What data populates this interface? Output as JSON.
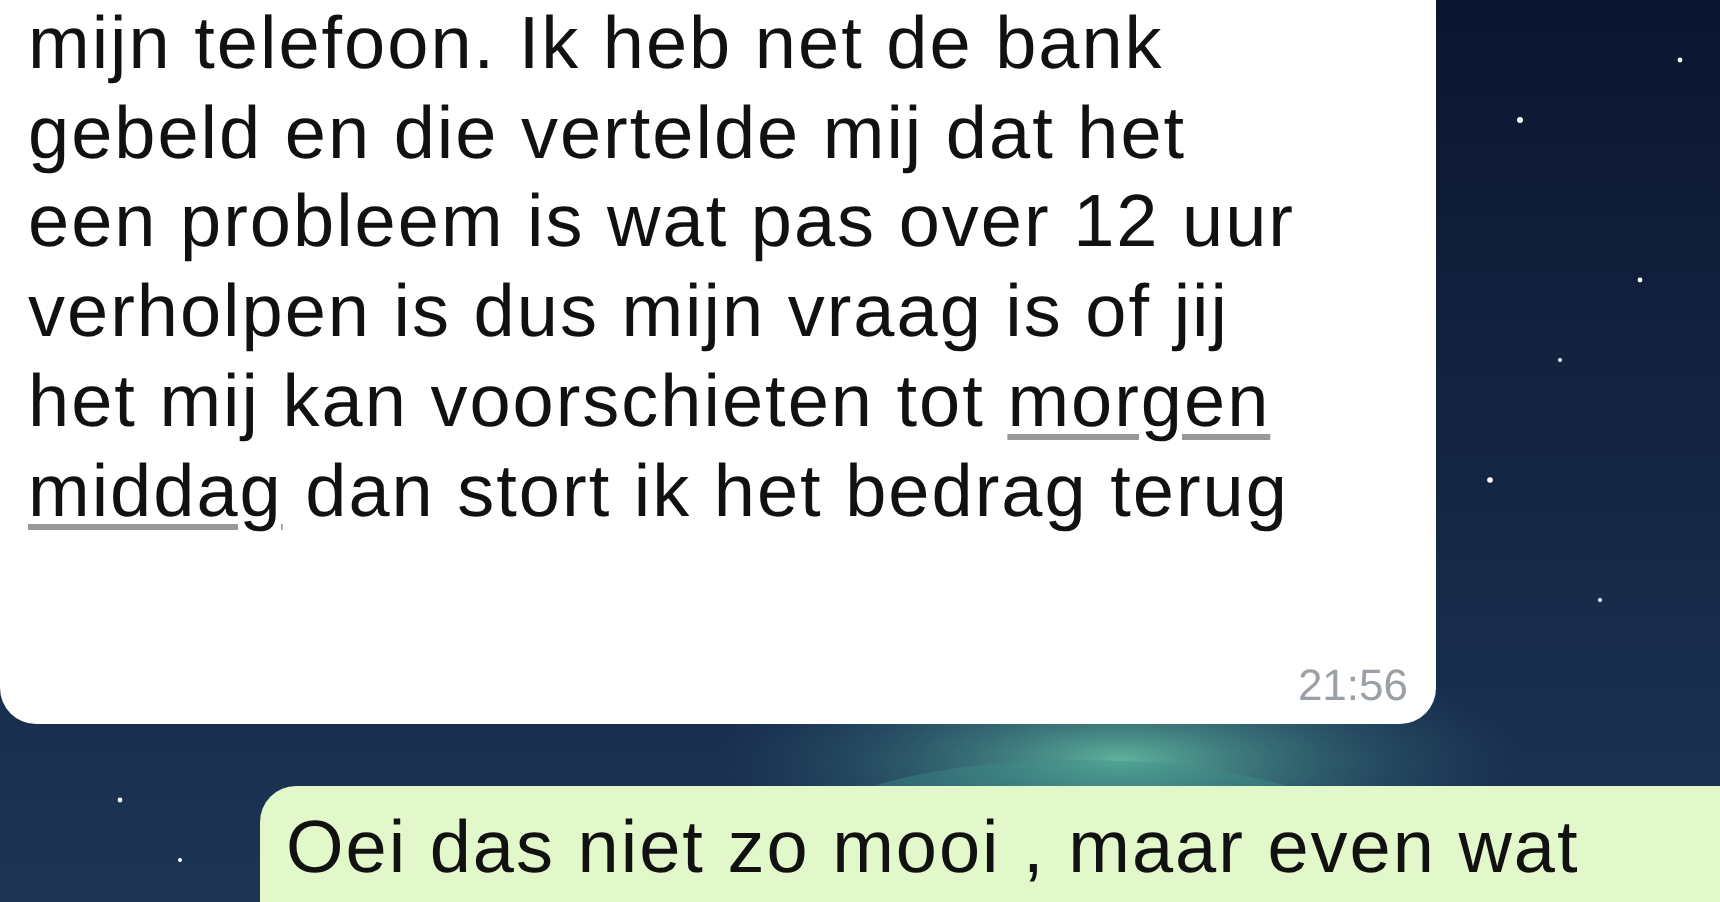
{
  "messages": [
    {
      "kind": "incoming",
      "lines": [
        [
          {
            "text": "mijn telefoon. Ik heb net de bank",
            "link": false
          }
        ],
        [
          {
            "text": "gebeld en die vertelde mij dat het",
            "link": false
          }
        ],
        [
          {
            "text": "een probleem is wat pas over 12 uur",
            "link": false
          }
        ],
        [
          {
            "text": "verholpen is dus mijn vraag is of jij",
            "link": false
          }
        ],
        [
          {
            "text": "het mij kan voorschieten tot ",
            "link": false
          },
          {
            "text": "morgen",
            "link": true
          }
        ],
        [
          {
            "text": "middag",
            "link": true
          },
          {
            "text": " dan stort ik het bedrag terug",
            "link": false
          }
        ]
      ],
      "time": "21:56"
    },
    {
      "kind": "outgoing",
      "lines": [
        [
          {
            "text": "Oei das niet zo mooi , maar even wat",
            "link": false
          }
        ]
      ]
    }
  ]
}
